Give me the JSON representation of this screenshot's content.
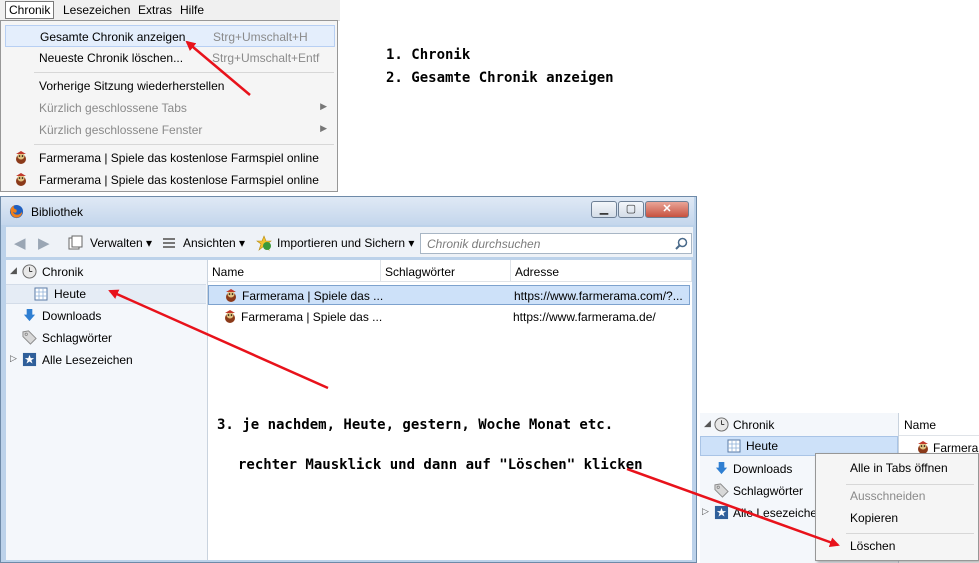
{
  "menubar": {
    "items": [
      "Chronik",
      "Lesezeichen",
      "Extras",
      "Hilfe"
    ]
  },
  "chronik_menu": {
    "items": [
      {
        "label": "Gesamte Chronik anzeigen",
        "shortcut": "Strg+Umschalt+H"
      },
      {
        "label": "Neueste Chronik löschen...",
        "shortcut": "Strg+Umschalt+Entf"
      },
      {
        "label": "Vorherige Sitzung wiederherstellen"
      },
      {
        "label": "Kürzlich geschlossene Tabs"
      },
      {
        "label": "Kürzlich geschlossene Fenster"
      },
      {
        "label": "Farmerama | Spiele das kostenlose Farmspiel online"
      },
      {
        "label": "Farmerama | Spiele das kostenlose Farmspiel online"
      }
    ]
  },
  "instructions": {
    "step1": "1. Chronik",
    "step2": "2. Gesamte Chronik anzeigen",
    "step3": "3. je nachdem, Heute, gestern, Woche Monat etc.",
    "step3b": "rechter Mausklick und dann auf \"Löschen\" klicken"
  },
  "library": {
    "title": "Bibliothek",
    "toolbar": {
      "manage": "Verwalten",
      "views": "Ansichten",
      "import": "Importieren und Sichern",
      "search_placeholder": "Chronik durchsuchen"
    },
    "sidebar": {
      "chronik": "Chronik",
      "heute": "Heute",
      "downloads": "Downloads",
      "tags": "Schlagwörter",
      "all_bookmarks": "Alle Lesezeichen"
    },
    "columns": [
      "Name",
      "Schlagwörter",
      "Adresse"
    ],
    "rows": [
      {
        "name": "Farmerama | Spiele das ...",
        "address": "https://www.farmerama.com/?..."
      },
      {
        "name": "Farmerama | Spiele das ...",
        "address": "https://www.farmerama.de/"
      }
    ]
  },
  "mini": {
    "chronik": "Chronik",
    "heute": "Heute",
    "downloads": "Downloads",
    "tags": "Schlagwörter",
    "all_bookmarks": "Alle Lesezeichen",
    "col_name": "Name",
    "row_name": "Farmerama"
  },
  "context_menu": {
    "open_all": "Alle in Tabs öffnen",
    "cut": "Ausschneiden",
    "copy": "Kopieren",
    "delete": "Löschen"
  },
  "colors": {
    "arrow": "#e8121b",
    "selection": "#cde1f9"
  }
}
